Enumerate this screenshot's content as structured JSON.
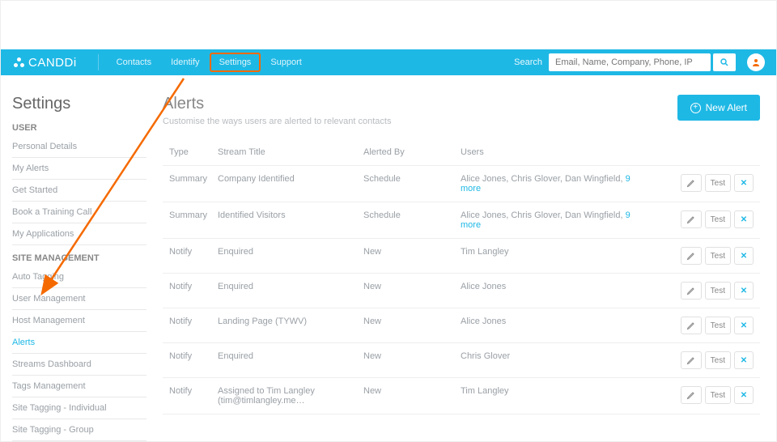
{
  "header": {
    "logo_text": "CANDDi",
    "nav": [
      {
        "label": "Contacts",
        "highlight": false
      },
      {
        "label": "Identify",
        "highlight": false
      },
      {
        "label": "Settings",
        "highlight": true
      },
      {
        "label": "Support",
        "highlight": false
      }
    ],
    "search_label": "Search",
    "search_placeholder": "Email, Name, Company, Phone, IP"
  },
  "sidebar": {
    "title": "Settings",
    "sections": [
      {
        "heading": "USER",
        "items": [
          {
            "label": "Personal Details"
          },
          {
            "label": "My Alerts"
          },
          {
            "label": "Get Started"
          },
          {
            "label": "Book a Training Call"
          },
          {
            "label": "My Applications"
          }
        ]
      },
      {
        "heading": "SITE MANAGEMENT",
        "items": [
          {
            "label": "Auto Tagging"
          },
          {
            "label": "User Management"
          },
          {
            "label": "Host Management"
          },
          {
            "label": "Alerts",
            "active": true
          },
          {
            "label": "Streams Dashboard"
          },
          {
            "label": "Tags Management"
          },
          {
            "label": "Site Tagging - Individual"
          },
          {
            "label": "Site Tagging - Group"
          }
        ]
      }
    ]
  },
  "main": {
    "title": "Alerts",
    "subtitle": "Customise the ways users are alerted to relevant contacts",
    "new_alert_label": "New Alert",
    "columns": {
      "type": "Type",
      "stream_title": "Stream Title",
      "alerted_by": "Alerted By",
      "users": "Users"
    },
    "test_label": "Test",
    "rows": [
      {
        "type": "Summary",
        "title": "Company Identified",
        "alerted_by": "Schedule",
        "users": "Alice Jones, Chris Glover, Dan Wingfield,",
        "more": "9 more"
      },
      {
        "type": "Summary",
        "title": "Identified Visitors",
        "alerted_by": "Schedule",
        "users": "Alice Jones, Chris Glover, Dan Wingfield,",
        "more": "9 more"
      },
      {
        "type": "Notify",
        "title": "Enquired",
        "alerted_by": "New",
        "users": "Tim Langley"
      },
      {
        "type": "Notify",
        "title": "Enquired",
        "alerted_by": "New",
        "users": "Alice Jones"
      },
      {
        "type": "Notify",
        "title": "Landing Page (TYWV)",
        "alerted_by": "New",
        "users": "Alice Jones"
      },
      {
        "type": "Notify",
        "title": "Enquired",
        "alerted_by": "New",
        "users": "Chris Glover"
      },
      {
        "type": "Notify",
        "title": "Assigned to Tim Langley (tim@timlangley.me…",
        "alerted_by": "New",
        "users": "Tim Langley"
      }
    ]
  }
}
